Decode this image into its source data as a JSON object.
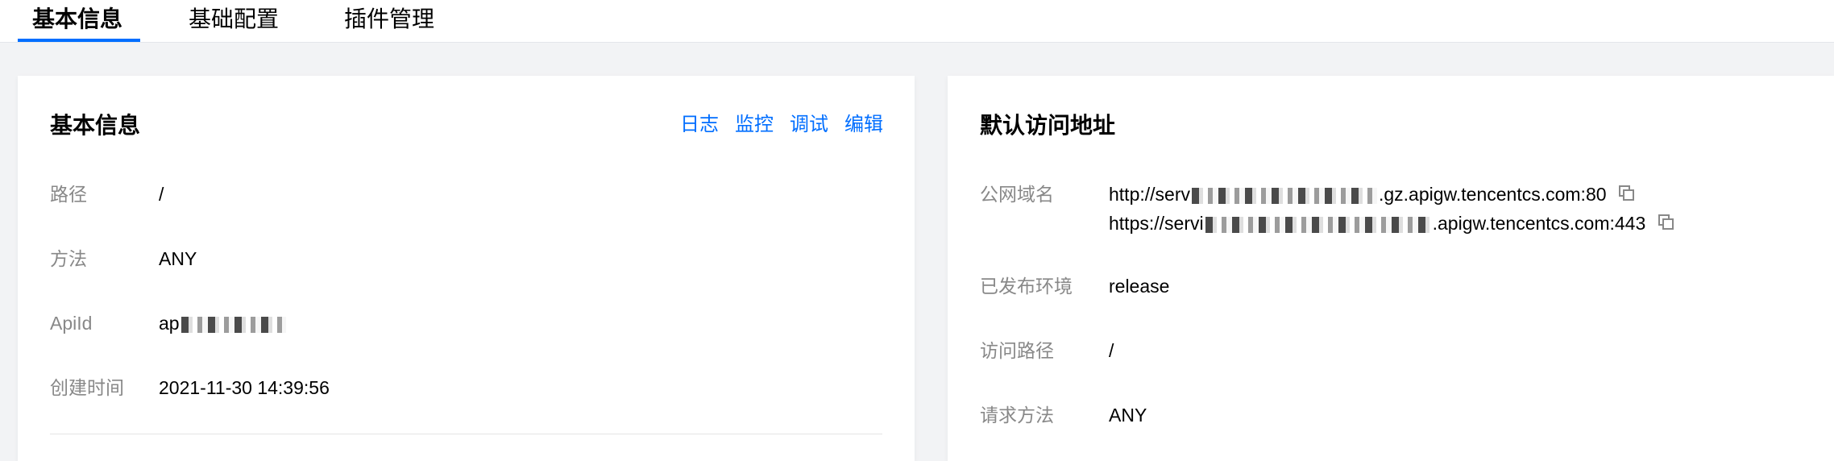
{
  "tabs": [
    {
      "label": "基本信息",
      "active": true
    },
    {
      "label": "基础配置",
      "active": false
    },
    {
      "label": "插件管理",
      "active": false
    }
  ],
  "basic_info": {
    "title": "基本信息",
    "actions": [
      "日志",
      "监控",
      "调试",
      "编辑"
    ],
    "fields": [
      {
        "label": "路径",
        "value": "/"
      },
      {
        "label": "方法",
        "value": "ANY"
      },
      {
        "label": "ApiId",
        "value_prefix": "ap"
      },
      {
        "label": "创建时间",
        "value": "2021-11-30 14:39:56"
      }
    ]
  },
  "default_access": {
    "title": "默认访问地址",
    "public_domain": {
      "label": "公网域名",
      "http_prefix": "http://serv",
      "http_suffix": ".gz.apigw.tencentcs.com:80",
      "https_prefix": "https://servi",
      "https_suffix": ".apigw.tencentcs.com:443"
    },
    "fields": [
      {
        "label": "已发布环境",
        "value": "release"
      },
      {
        "label": "访问路径",
        "value": "/"
      },
      {
        "label": "请求方法",
        "value": "ANY"
      }
    ]
  },
  "colors": {
    "accent": "#006eff",
    "label_gray": "#888888",
    "background": "#f2f3f5"
  },
  "icons": [
    "copy-icon"
  ]
}
